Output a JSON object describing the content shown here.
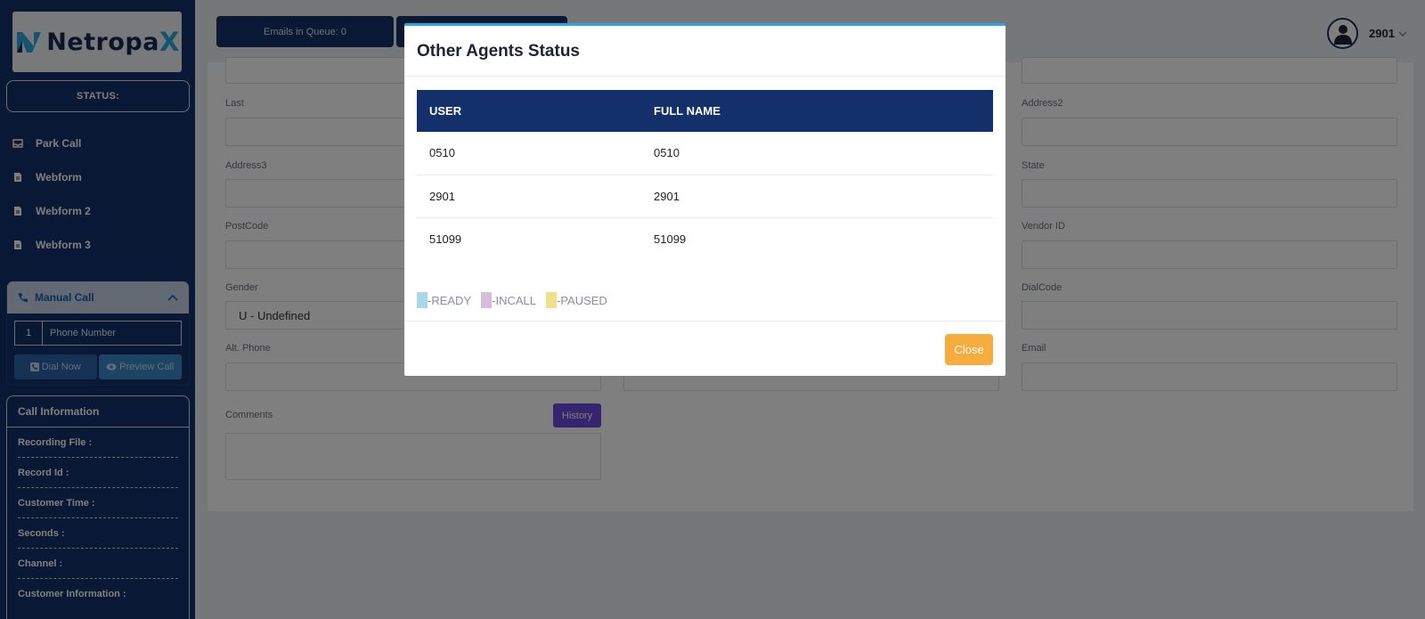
{
  "sidebar": {
    "logo_text": "Netropa",
    "logo_x": "X",
    "status_label": "STATUS:",
    "nav": [
      {
        "label": "Park Call",
        "icon": "inbox-icon"
      },
      {
        "label": "Webform",
        "icon": "file-icon"
      },
      {
        "label": "Webform 2",
        "icon": "file-icon"
      },
      {
        "label": "Webform 3",
        "icon": "file-icon"
      }
    ],
    "manual_call": {
      "title": "Manual Call",
      "dial_code": "1",
      "phone_placeholder": "Phone Number",
      "dial_label": "Dial Now",
      "preview_label": "Preview Call"
    },
    "call_info": {
      "title": "Call Information",
      "rows": [
        "Recording File :",
        "Record Id :",
        "Customer Time :",
        "Seconds :",
        "Channel :",
        "Customer Information :"
      ]
    }
  },
  "topbar": {
    "queue_label": "Emails in Queue: 0",
    "user": "2901"
  },
  "form": {
    "labels": {
      "last": "Last",
      "address2": "Address2",
      "address3": "Address3",
      "state": "State",
      "postcode": "PostCode",
      "vendor_id": "Vendor ID",
      "gender": "Gender",
      "dialcode": "DialCode",
      "alt_phone": "Alt. Phone",
      "email": "Email",
      "comments": "Comments"
    },
    "gender_value": "U - Undefined",
    "history_label": "History"
  },
  "modal": {
    "title": "Other Agents Status",
    "columns": [
      "USER",
      "FULL NAME"
    ],
    "rows": [
      [
        "0510",
        "0510"
      ],
      [
        "2901",
        "2901"
      ],
      [
        "51099",
        "51099"
      ]
    ],
    "legend": [
      {
        "label": "-READY",
        "color": "#a8d8e8"
      },
      {
        "label": "-INCALL",
        "color": "#d8bcdc"
      },
      {
        "label": "-PAUSED",
        "color": "#efe08a"
      }
    ],
    "close_label": "Close"
  },
  "colors": {
    "sidebar_bg": "#13306a",
    "accent": "#29a6e6",
    "close_btn": "#f6ad3e",
    "history_btn": "#6a4be0"
  }
}
